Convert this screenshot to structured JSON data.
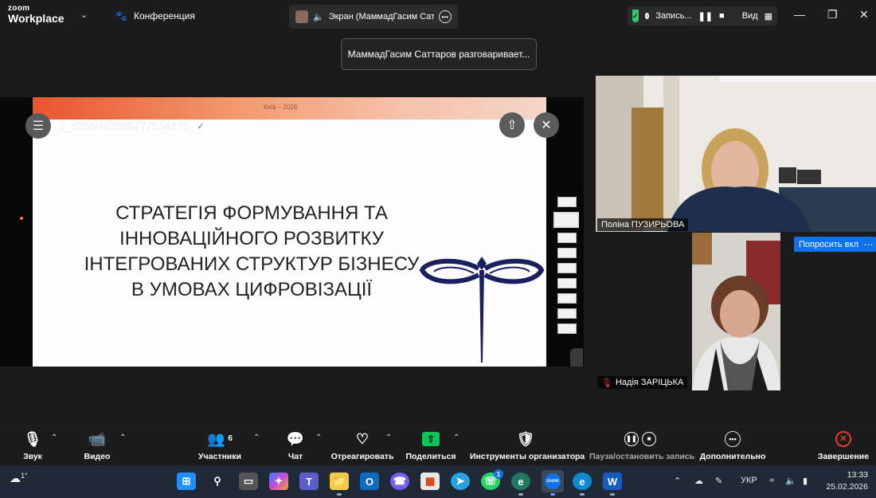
{
  "app": {
    "logo_line1": "zoom",
    "logo_line2": "Workplace",
    "meeting_title": "Конференция"
  },
  "screen_tab": {
    "label": "Экран (МаммадГасим Саттаров)"
  },
  "recording": {
    "label": "Запись...",
    "view_label": "Вид"
  },
  "toast": {
    "text": "МаммадГасим Саттаров разговаривает..."
  },
  "shared_file": {
    "name": "2_5256073589777534275",
    "slide_header": "Київ – 2026",
    "slide_title": "СТРАТЕГІЯ ФОРМУВАННЯ ТА ІННОВАЦІЙНОГО РОЗВИТКУ ІНТЕГРОВАНИХ СТРУКТУР БІЗНЕСУ В УМОВАХ ЦИФРОВІЗАЦІЇ"
  },
  "participants_video": [
    {
      "name": "Поліна ПУЗИРЬОВА"
    },
    {
      "name": "Надія ЗАРІЦЬКА"
    }
  ],
  "ask_button": "Попросить вкл",
  "toolbar": {
    "audio": "Звук",
    "video": "Видео",
    "participants": "Участники",
    "participants_count": "6",
    "chat": "Чат",
    "react": "Отреагировать",
    "share": "Поделиться",
    "host_tools": "Инструменты организатора",
    "pause_record": "Пауза/остановить запись",
    "more": "Дополнительно",
    "end": "Завершение"
  },
  "taskbar": {
    "weather_temp": "1°",
    "lang": "УКР",
    "time": "13:33",
    "date": "25.02.2026",
    "telegram_badge": "1"
  },
  "colors": {
    "accent": "#0e72ed",
    "share_green": "#12c35a",
    "end_red": "#e53935",
    "shield_green": "#2ecc71"
  }
}
